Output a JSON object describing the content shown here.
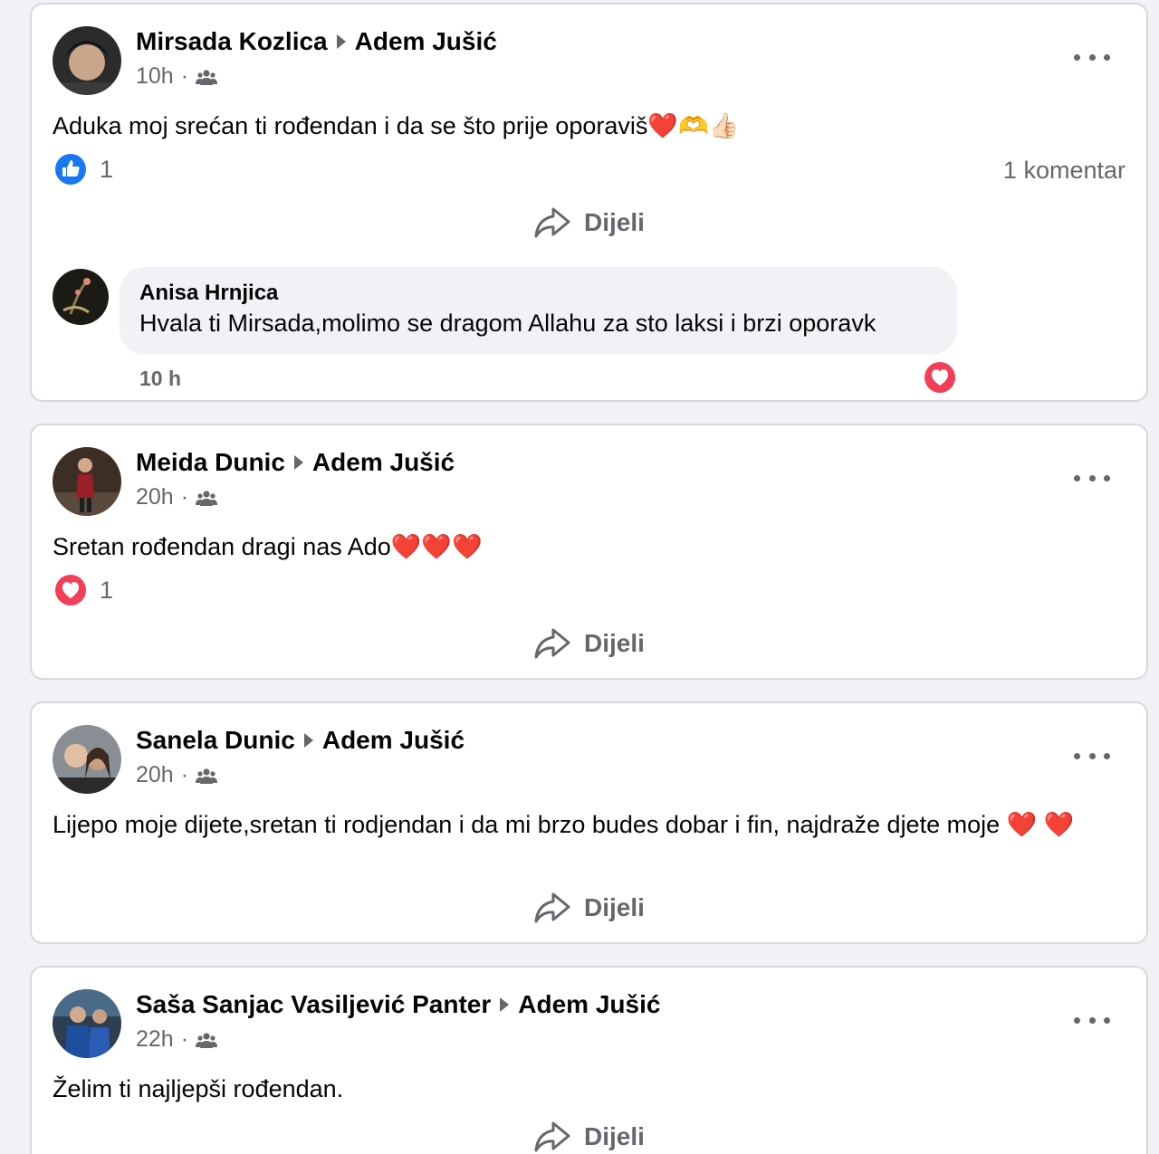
{
  "posts": [
    {
      "author": "Mirsada Kozlica",
      "target": "Adem Jušić",
      "time": "10h",
      "separator": "·",
      "audience_icon": "friends-icon",
      "text": "Aduka moj srećan ti rođendan i da se što prije oporaviš❤️🫶👍🏻",
      "reaction_icon": "like-icon",
      "reaction_count": "1",
      "comment_count": "1 komentar",
      "share_label": "Dijeli",
      "comment": {
        "author": "Anisa Hrnjica",
        "text": "Hvala ti Mirsada,molimo se dragom Allahu za sto laksi i brzi oporavk",
        "time": "10 h",
        "reaction_icon": "love-icon"
      }
    },
    {
      "author": "Meida Dunic",
      "target": "Adem Jušić",
      "time": "20h",
      "separator": "·",
      "audience_icon": "friends-icon",
      "text": "Sretan rođendan dragi nas Ado❤️❤️❤️",
      "reaction_icon": "love-icon",
      "reaction_count": "1",
      "share_label": "Dijeli"
    },
    {
      "author": "Sanela Dunic",
      "target": "Adem Jušić",
      "time": "20h",
      "separator": "·",
      "audience_icon": "friends-icon",
      "text": "Lijepo moje dijete,sretan ti rodjendan i da mi brzo budes dobar i fin, najdraže djete moje ❤️ ❤️",
      "share_label": "Dijeli"
    },
    {
      "author": "Saša Sanjac Vasiljević Panter",
      "target": "Adem Jušić",
      "time": "22h",
      "separator": "·",
      "audience_icon": "friends-icon",
      "text": "Želim ti najljepši rođendan.",
      "share_label": "Dijeli"
    }
  ],
  "colors": {
    "like_blue": "#1877f2",
    "love_red": "#f33e58",
    "secondary_text": "#65676b"
  }
}
